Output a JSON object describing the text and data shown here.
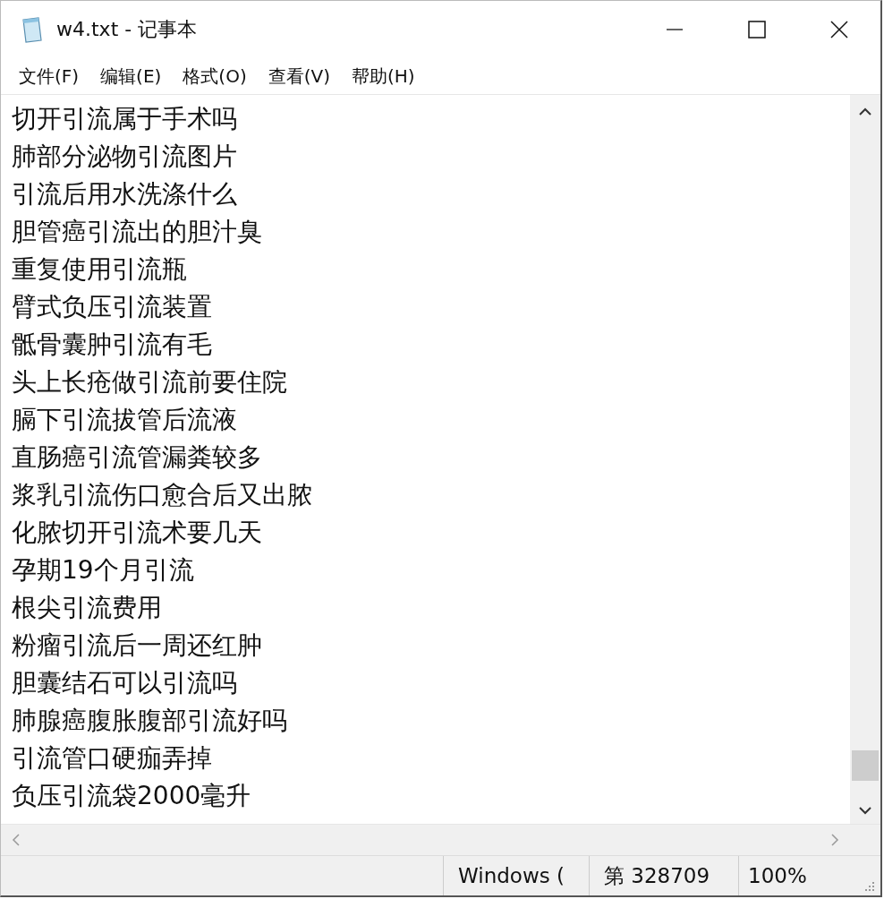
{
  "window": {
    "title": "w4.txt - 记事本"
  },
  "menu": [
    "文件(F)",
    "编辑(E)",
    "格式(O)",
    "查看(V)",
    "帮助(H)"
  ],
  "lines": [
    "切开引流属于手术吗",
    "肺部分泌物引流图片",
    "引流后用水洗涤什么",
    "胆管癌引流出的胆汁臭",
    "重复使用引流瓶",
    "臂式负压引流装置",
    "骶骨囊肿引流有毛",
    "头上长疮做引流前要住院",
    "膈下引流拔管后流液",
    "直肠癌引流管漏粪较多",
    "浆乳引流伤口愈合后又出脓",
    "化脓切开引流术要几天",
    "孕期19个月引流",
    "根尖引流费用",
    "粉瘤引流后一周还红肿",
    "胆囊结石可以引流吗",
    "肺腺癌腹胀腹部引流好吗",
    "引流管口硬痂弄掉",
    "负压引流袋2000毫升"
  ],
  "status_bar": [
    "Windows (",
    "第 328709",
    "100%"
  ]
}
